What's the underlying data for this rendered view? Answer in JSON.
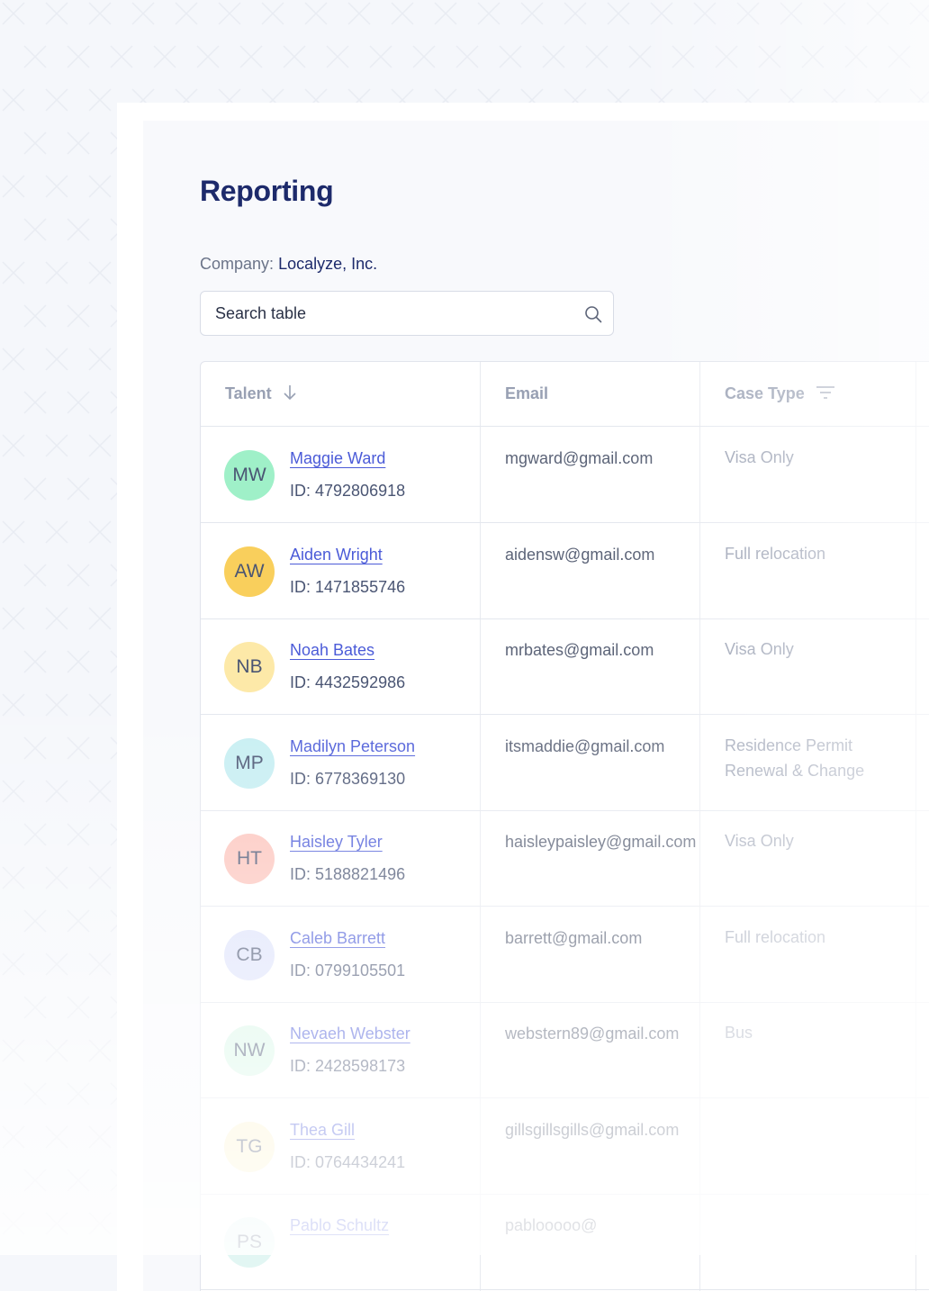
{
  "page": {
    "title": "Reporting",
    "company_label": "Company:",
    "company_value": "Localyze, Inc."
  },
  "search": {
    "placeholder": "Search table",
    "icon": "search-icon"
  },
  "table": {
    "columns": [
      {
        "label": "Talent",
        "icon": "arrow-down-icon"
      },
      {
        "label": "Email",
        "icon": ""
      },
      {
        "label": "Case Type",
        "icon": "filter-icon"
      }
    ],
    "rows": [
      {
        "initials": "MW",
        "name": "Maggie Ward",
        "id": "ID: 4792806918",
        "email": "mgward@gmail.com",
        "case_type": "Visa Only",
        "avatar_color": "#9ff0c8"
      },
      {
        "initials": "AW",
        "name": "Aiden Wright",
        "id": "ID: 1471855746",
        "email": "aidensw@gmail.com",
        "case_type": "Full relocation",
        "avatar_color": "#f9cf5c"
      },
      {
        "initials": "NB",
        "name": "Noah Bates",
        "id": "ID: 4432592986",
        "email": "mrbates@gmail.com",
        "case_type": "Visa Only",
        "avatar_color": "#fde9a8"
      },
      {
        "initials": "MP",
        "name": "Madilyn Peterson",
        "id": "ID: 6778369130",
        "email": "itsmaddie@gmail.com",
        "case_type": "Residence Permit Renewal & Change",
        "avatar_color": "#c6eef2"
      },
      {
        "initials": "HT",
        "name": "Haisley Tyler",
        "id": "ID: 5188821496",
        "email": "haisleypaisley@gmail.com",
        "case_type": "Visa Only",
        "avatar_color": "#fcc4bc"
      },
      {
        "initials": "CB",
        "name": "Caleb Barrett",
        "id": "ID: 0799105501",
        "email": "barrett@gmail.com",
        "case_type": "Full relocation",
        "avatar_color": "#dde2fb"
      },
      {
        "initials": "NW",
        "name": "Nevaeh Webster",
        "id": "ID: 2428598173",
        "email": "webstern89@gmail.com",
        "case_type": "Bus",
        "avatar_color": "#d9f7e8"
      },
      {
        "initials": "TG",
        "name": "Thea Gill",
        "id": "ID: 0764434241",
        "email": "gillsgillsgills@gmail.com",
        "case_type": "",
        "avatar_color": "#fdf3cf"
      },
      {
        "initials": "PS",
        "name": "Pablo Schultz",
        "id": "",
        "email": "pablooooo@",
        "case_type": "",
        "avatar_color": "#e2f6f3"
      }
    ]
  }
}
